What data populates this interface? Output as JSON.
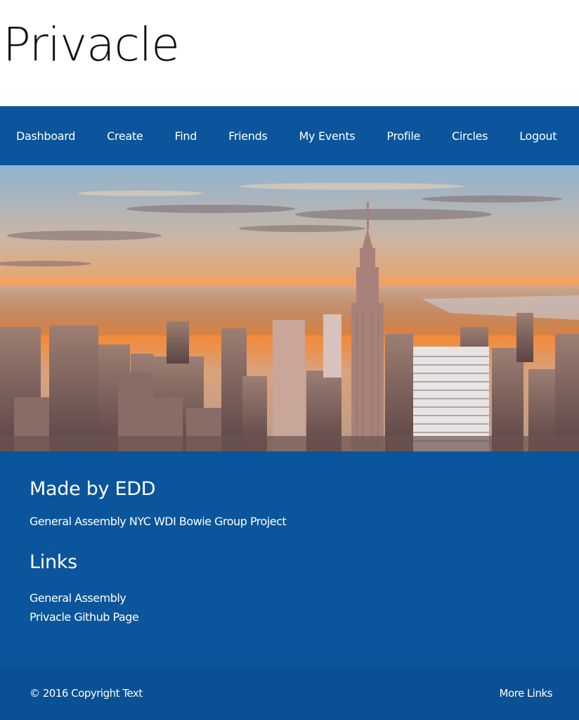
{
  "header": {
    "brand": "Privacle"
  },
  "nav": {
    "items": [
      {
        "label": "Dashboard"
      },
      {
        "label": "Create"
      },
      {
        "label": "Find"
      },
      {
        "label": "Friends"
      },
      {
        "label": "My Events"
      },
      {
        "label": "Profile"
      },
      {
        "label": "Circles"
      },
      {
        "label": "Logout"
      }
    ]
  },
  "colors": {
    "nav_bg": "#0a559b",
    "footer_bg": "#0a5094"
  },
  "content": {
    "heading": "Made by EDD",
    "description": "General Assembly NYC WDI Bowie Group Project",
    "links_heading": "Links",
    "links": [
      {
        "label": "General Assembly"
      },
      {
        "label": "Privacle Github Page"
      }
    ]
  },
  "footer": {
    "copyright": "© 2016 Copyright Text",
    "more_links": "More Links"
  }
}
